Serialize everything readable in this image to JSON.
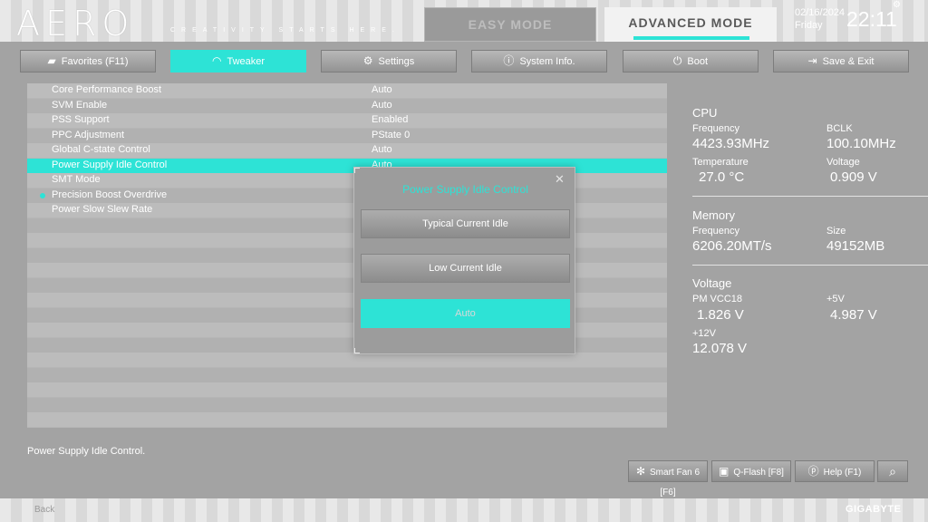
{
  "header": {
    "logo": "AERO",
    "tagline": "CREATIVITY STARTS HERE.",
    "mode_tabs": [
      {
        "label": "EASY MODE",
        "active": false
      },
      {
        "label": "ADVANCED MODE",
        "active": true
      }
    ],
    "date": "02/16/2024",
    "weekday": "Friday",
    "time": "22:11",
    "accent_color": "#2de3d6"
  },
  "tabs": [
    {
      "label": "Favorites (F11)",
      "icon": "folder-star-icon",
      "active": false
    },
    {
      "label": "Tweaker",
      "icon": "gauge-icon",
      "active": true
    },
    {
      "label": "Settings",
      "icon": "gear-icon",
      "active": false
    },
    {
      "label": "System Info.",
      "icon": "info-icon",
      "active": false
    },
    {
      "label": "Boot",
      "icon": "power-icon",
      "active": false
    },
    {
      "label": "Save & Exit",
      "icon": "exit-icon",
      "active": false
    }
  ],
  "settings": [
    {
      "label": "Core Performance Boost",
      "value": "Auto"
    },
    {
      "label": "SVM Enable",
      "value": "Auto"
    },
    {
      "label": "PSS Support",
      "value": "Enabled"
    },
    {
      "label": "PPC Adjustment",
      "value": "PState 0"
    },
    {
      "label": "Global C-state Control",
      "value": "Auto"
    },
    {
      "label": "Power Supply Idle Control",
      "value": "Auto",
      "selected": true
    },
    {
      "label": "SMT Mode",
      "value": ""
    },
    {
      "label": "Precision Boost Overdrive",
      "value": "",
      "bullet": true
    },
    {
      "label": "Power Slow Slew Rate",
      "value": ""
    }
  ],
  "info": {
    "cpu": {
      "title": "CPU",
      "frequency_label": "Frequency",
      "frequency": "4423.93MHz",
      "bclk_label": "BCLK",
      "bclk": "100.10MHz",
      "temperature_label": "Temperature",
      "temperature": "27.0 °C",
      "voltage_label": "Voltage",
      "voltage": "0.909 V"
    },
    "memory": {
      "title": "Memory",
      "frequency_label": "Frequency",
      "frequency": "6206.20MT/s",
      "size_label": "Size",
      "size": "49152MB"
    },
    "voltage": {
      "title": "Voltage",
      "pmvcc18_label": "PM VCC18",
      "pmvcc18": "1.826 V",
      "v5_label": "+5V",
      "v5": "4.987 V",
      "v12_label": "+12V",
      "v12": "12.078 V"
    }
  },
  "modal": {
    "title": "Power Supply Idle Control",
    "options": [
      {
        "label": "Typical Current Idle",
        "active": false
      },
      {
        "label": "Low Current Idle",
        "active": false
      },
      {
        "label": "Auto",
        "active": true
      }
    ]
  },
  "footer": {
    "help_text": "Power Supply Idle Control.",
    "buttons": [
      {
        "label": "Smart Fan 6 [F6]",
        "icon": "fan-icon"
      },
      {
        "label": "Q-Flash [F8]",
        "icon": "chip-icon"
      },
      {
        "label": "Help (F1)",
        "icon": "help-icon"
      },
      {
        "label": "",
        "icon": "search-icon"
      }
    ],
    "back_label": "Back",
    "brand": "GIGABYTE"
  }
}
